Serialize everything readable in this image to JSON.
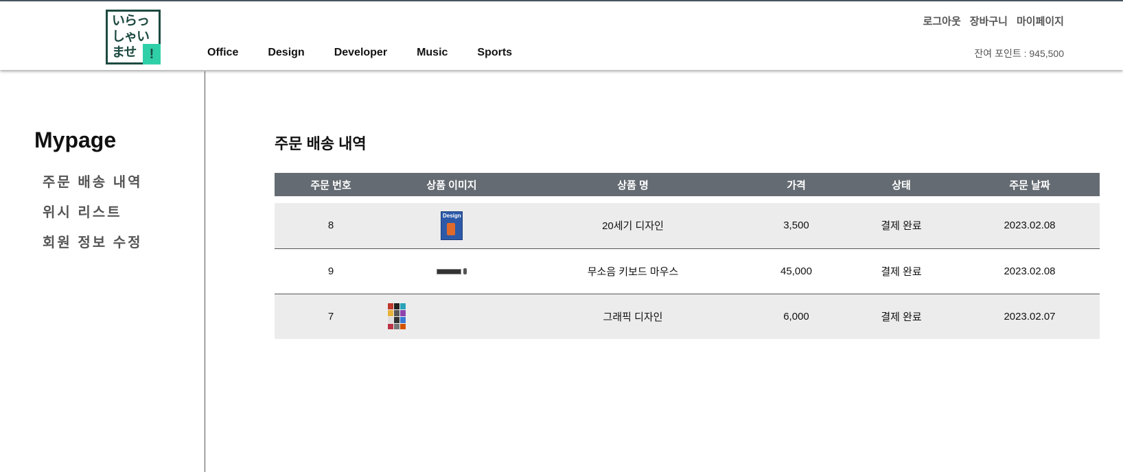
{
  "brand": {
    "logo_kana": [
      "いらっ",
      "しゃい",
      "ませ"
    ],
    "logo_mark": "!",
    "colors": {
      "logo_dark": "#1c4a40",
      "logo_accent": "#2fd0a8"
    }
  },
  "header": {
    "categories": [
      "Office",
      "Design",
      "Developer",
      "Music",
      "Sports"
    ],
    "user_links": [
      "로그아웃",
      "장바구니",
      "마이페이지"
    ],
    "points_text": "잔여 포인트 : 945,500"
  },
  "sidebar": {
    "title": "Mypage",
    "items": [
      "주문 배송 내역",
      "위시 리스트",
      "회원 정보 수정"
    ]
  },
  "main": {
    "title": "주문 배송 내역",
    "columns": [
      "주문 번호",
      "상품 이미지",
      "상품 명",
      "가격",
      "상태",
      "주문 날짜"
    ],
    "orders": [
      {
        "order_no": "8",
        "image_icon": "design-book-thumbnail",
        "name": "20세기 디자인",
        "price": "3,500",
        "status": "결제 완료",
        "date": "2023.02.08"
      },
      {
        "order_no": "9",
        "image_icon": "keyboard-mouse-thumbnail",
        "name": "무소음 키보드 마우스",
        "price": "45,000",
        "status": "결제 완료",
        "date": "2023.02.08"
      },
      {
        "order_no": "7",
        "image_icon": "graphic-design-book-thumbnail",
        "name": "그래픽 디자인",
        "price": "6,000",
        "status": "결제 완료",
        "date": "2023.02.07"
      }
    ]
  },
  "colors": {
    "table_header": "#646b72",
    "row_shade": "#ececec"
  }
}
